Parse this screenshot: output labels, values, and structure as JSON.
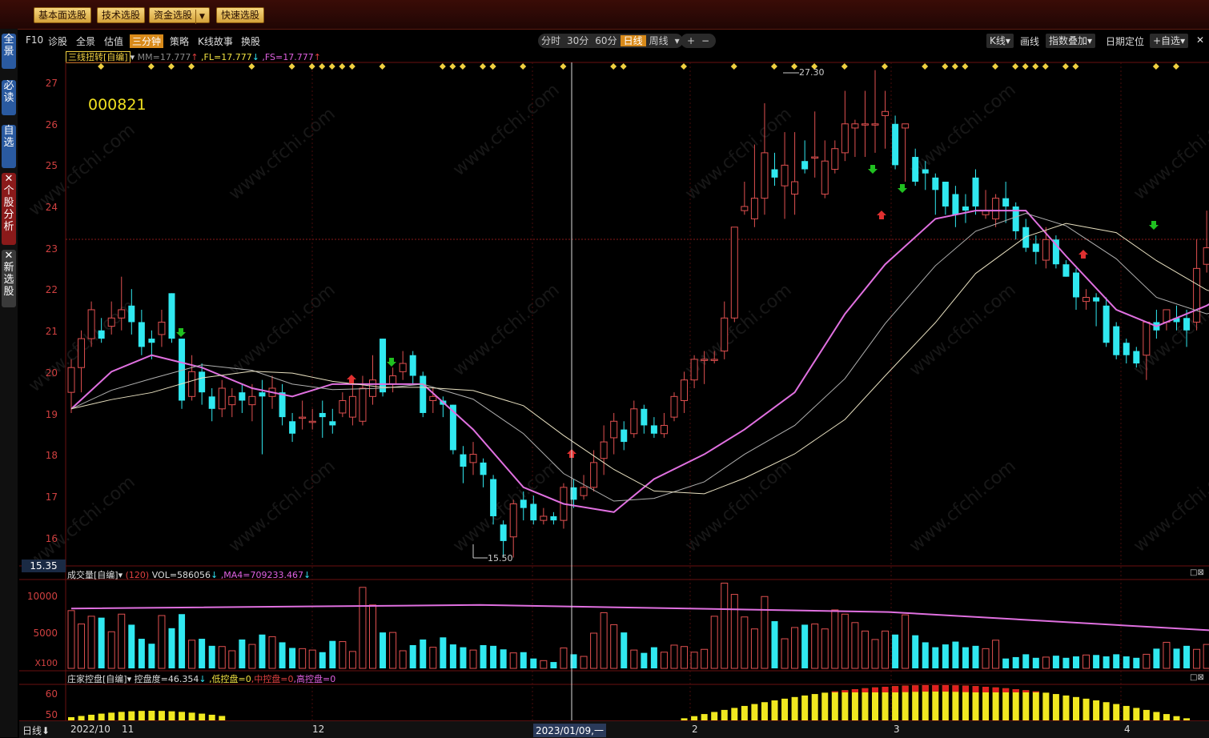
{
  "toolbar": {
    "buttons": [
      "基本面选股",
      "技术选股",
      "资金选股",
      "快速选股"
    ]
  },
  "left_tabs": [
    "全景",
    "必读",
    "自选",
    "个股分析",
    "新选股"
  ],
  "nav": {
    "items": [
      "F10",
      "诊股",
      "全景",
      "估值",
      "三分钟",
      "策略",
      "K线故事",
      "换股"
    ],
    "active": "三分钟",
    "periods": [
      "分时",
      "30分",
      "60分",
      "日线",
      "周线"
    ],
    "period_active": "日线",
    "zoom_in": "+",
    "zoom_out": "−",
    "right": [
      "K线",
      "画线",
      "指数叠加",
      "日期定位",
      "+自选"
    ]
  },
  "main_legend": {
    "name": "三线扭转[自编]",
    "mm": "MM=17.777",
    "fl": ",FL=17.777",
    "fs": ",FS=17.777"
  },
  "stock_code": "000821",
  "price_axis": [
    "27",
    "26",
    "25",
    "24",
    "23",
    "22",
    "21",
    "20",
    "19",
    "18",
    "17",
    "16"
  ],
  "current_price_label": "15.35",
  "high_label": "27.30",
  "low_label": "15.50",
  "volume_legend": {
    "name": "成交量[自编]",
    "period": "(120)",
    "vol": "VOL=586056",
    "ma": ",MA4=709233.467"
  },
  "volume_axis": [
    "10000",
    "5000",
    "X100"
  ],
  "control_legend": {
    "name": "庄家控盘[自编]",
    "degree": "控盘度=46.354",
    "low": ",低控盘=0",
    "mid": ",中控盘=0",
    "high": ",高控盘=0"
  },
  "control_axis": [
    "60",
    "50"
  ],
  "date_axis": {
    "period_button": "日线",
    "labels": [
      "2022/10",
      "11",
      "12",
      "2023/01/09,一",
      "2",
      "3",
      "4"
    ]
  },
  "watermark": "www.cfchi.com",
  "colors": {
    "up": "#e05050",
    "down": "#30e8f0",
    "ma_pink": "#e070e0",
    "ma_light": "#e8e0c0",
    "ma_gray": "#b0b0b0",
    "signal_diamond": "#f0d040",
    "buy_arrow": "#e03030",
    "sell_arrow": "#20c020"
  },
  "chart_data": {
    "type": "candlestick",
    "ylim": [
      15.3,
      27.4
    ],
    "candles": [
      [
        19.5,
        20.1,
        19.0,
        20.3
      ],
      [
        20.1,
        20.8,
        19.5,
        21.0
      ],
      [
        20.8,
        21.5,
        20.6,
        21.7
      ],
      [
        21.0,
        20.8,
        20.7,
        21.3
      ],
      [
        21.1,
        21.3,
        20.9,
        21.7
      ],
      [
        21.3,
        21.5,
        21.0,
        22.3
      ],
      [
        21.6,
        21.2,
        20.9,
        22.0
      ],
      [
        21.2,
        20.6,
        20.4,
        21.5
      ],
      [
        20.8,
        20.7,
        20.3,
        21.0
      ],
      [
        20.9,
        21.2,
        20.6,
        21.5
      ],
      [
        21.9,
        20.8,
        20.7,
        21.9
      ],
      [
        20.8,
        19.3,
        19.1,
        20.8
      ],
      [
        19.4,
        20.0,
        19.3,
        20.4
      ],
      [
        20.0,
        19.5,
        19.2,
        20.2
      ],
      [
        19.4,
        19.1,
        18.8,
        19.6
      ],
      [
        19.1,
        19.6,
        18.9,
        19.8
      ],
      [
        19.2,
        19.4,
        18.9,
        19.6
      ],
      [
        19.5,
        19.3,
        19.0,
        19.7
      ],
      [
        19.2,
        19.4,
        18.8,
        19.7
      ],
      [
        19.5,
        19.4,
        18.0,
        19.8
      ],
      [
        19.4,
        19.6,
        19.1,
        19.9
      ],
      [
        19.5,
        18.9,
        18.7,
        19.7
      ],
      [
        18.8,
        18.5,
        18.3,
        19.0
      ],
      [
        18.9,
        18.9,
        18.6,
        19.3
      ],
      [
        18.8,
        18.8,
        18.6,
        19.1
      ],
      [
        19.0,
        18.9,
        18.4,
        19.3
      ],
      [
        18.8,
        18.7,
        18.5,
        19.1
      ],
      [
        19.0,
        19.3,
        18.9,
        19.5
      ],
      [
        18.9,
        19.4,
        18.7,
        19.7
      ],
      [
        18.8,
        19.6,
        18.7,
        19.9
      ],
      [
        19.4,
        19.8,
        19.2,
        20.4
      ],
      [
        20.8,
        19.5,
        19.4,
        20.8
      ],
      [
        19.7,
        19.9,
        19.5,
        20.1
      ],
      [
        20.0,
        20.2,
        19.8,
        20.5
      ],
      [
        20.4,
        19.9,
        19.7,
        20.5
      ],
      [
        19.9,
        19.0,
        18.9,
        20.0
      ],
      [
        19.3,
        19.4,
        19.0,
        19.6
      ],
      [
        19.3,
        19.2,
        18.9,
        19.4
      ],
      [
        19.2,
        18.1,
        18.0,
        19.2
      ],
      [
        18.0,
        17.7,
        17.3,
        18.2
      ],
      [
        17.8,
        18.0,
        17.5,
        18.3
      ],
      [
        17.8,
        17.5,
        17.2,
        17.9
      ],
      [
        17.4,
        16.5,
        16.3,
        17.5
      ],
      [
        16.3,
        15.9,
        15.5,
        16.4
      ],
      [
        16.0,
        16.8,
        15.5,
        16.9
      ],
      [
        16.9,
        16.7,
        16.4,
        17.1
      ],
      [
        16.8,
        16.4,
        16.3,
        17.0
      ],
      [
        16.4,
        16.5,
        16.3,
        16.7
      ],
      [
        16.5,
        16.4,
        16.3,
        16.6
      ],
      [
        16.4,
        17.2,
        16.2,
        17.3
      ],
      [
        17.2,
        16.9,
        16.7,
        17.4
      ],
      [
        17.0,
        17.2,
        16.9,
        17.5
      ],
      [
        17.2,
        17.8,
        17.1,
        18.1
      ],
      [
        17.9,
        18.3,
        17.5,
        18.7
      ],
      [
        18.4,
        18.8,
        18.0,
        19.0
      ],
      [
        18.6,
        18.3,
        18.1,
        18.8
      ],
      [
        18.5,
        19.1,
        18.4,
        19.3
      ],
      [
        19.1,
        18.7,
        18.5,
        19.2
      ],
      [
        18.7,
        18.5,
        18.4,
        18.9
      ],
      [
        18.5,
        18.7,
        18.4,
        19.0
      ],
      [
        18.9,
        19.4,
        18.8,
        19.5
      ],
      [
        19.3,
        19.8,
        19.0,
        20.0
      ],
      [
        19.8,
        20.3,
        19.6,
        20.4
      ],
      [
        20.3,
        20.3,
        19.7,
        20.5
      ],
      [
        20.3,
        20.3,
        20.2,
        20.5
      ],
      [
        20.5,
        21.3,
        20.3,
        21.7
      ],
      [
        21.3,
        23.5,
        21.2,
        23.5
      ],
      [
        23.9,
        24.0,
        23.8,
        24.6
      ],
      [
        23.7,
        24.2,
        23.5,
        25.5
      ],
      [
        24.2,
        25.3,
        23.8,
        26.5
      ],
      [
        24.9,
        24.7,
        24.5,
        25.3
      ],
      [
        24.5,
        25.0,
        23.7,
        25.8
      ],
      [
        24.3,
        24.6,
        23.8,
        25.8
      ],
      [
        25.1,
        24.9,
        24.8,
        25.6
      ],
      [
        25.2,
        25.2,
        24.7,
        26.3
      ],
      [
        24.3,
        25.1,
        24.2,
        25.6
      ],
      [
        24.9,
        25.4,
        24.8,
        25.6
      ],
      [
        25.3,
        26.0,
        25.1,
        26.8
      ],
      [
        25.9,
        26.0,
        25.2,
        26.1
      ],
      [
        26.0,
        26.0,
        25.2,
        26.8
      ],
      [
        26.0,
        26.0,
        25.3,
        27.3
      ],
      [
        26.2,
        26.3,
        25.4,
        26.8
      ],
      [
        26.0,
        25.0,
        24.9,
        26.2
      ],
      [
        25.9,
        26.0,
        24.6,
        25.9
      ],
      [
        25.2,
        24.6,
        24.5,
        25.4
      ],
      [
        24.9,
        24.8,
        24.4,
        25.1
      ],
      [
        24.7,
        24.4,
        23.8,
        24.8
      ],
      [
        24.6,
        24.0,
        23.8,
        24.6
      ],
      [
        24.3,
        23.8,
        23.5,
        24.5
      ],
      [
        24.0,
        23.9,
        23.6,
        24.3
      ],
      [
        24.7,
        24.0,
        23.8,
        24.9
      ],
      [
        23.8,
        23.9,
        23.7,
        24.4
      ],
      [
        23.7,
        24.2,
        23.5,
        24.3
      ],
      [
        24.2,
        24.0,
        23.6,
        24.6
      ],
      [
        24.0,
        23.4,
        23.2,
        24.1
      ],
      [
        23.5,
        23.0,
        22.9,
        23.7
      ],
      [
        23.1,
        22.9,
        22.6,
        23.3
      ],
      [
        22.7,
        23.2,
        22.5,
        23.5
      ],
      [
        23.2,
        22.6,
        22.5,
        23.3
      ],
      [
        22.6,
        22.3,
        22.3,
        22.7
      ],
      [
        22.4,
        21.8,
        21.5,
        22.5
      ],
      [
        21.7,
        21.8,
        21.5,
        22.0
      ],
      [
        21.8,
        21.7,
        21.1,
        21.9
      ],
      [
        21.6,
        20.7,
        20.6,
        21.8
      ],
      [
        21.1,
        20.4,
        20.3,
        21.2
      ],
      [
        20.7,
        20.4,
        20.2,
        20.8
      ],
      [
        20.5,
        20.2,
        20.1,
        20.6
      ],
      [
        20.4,
        21.2,
        19.8,
        21.2
      ],
      [
        21.2,
        21.0,
        20.8,
        21.5
      ],
      [
        21.2,
        21.5,
        21.0,
        21.5
      ],
      [
        21.3,
        21.2,
        21.0,
        21.6
      ],
      [
        21.3,
        21.0,
        20.6,
        21.5
      ],
      [
        21.2,
        22.5,
        21.0,
        23.2
      ],
      [
        22.6,
        23.0,
        22.4,
        23.9
      ],
      [
        22.7,
        22.3,
        22.2,
        23.2
      ],
      [
        22.6,
        23.4,
        22.4,
        23.8
      ],
      [
        23.1,
        24.0,
        22.9,
        24.0
      ],
      [
        23.6,
        23.7,
        23.4,
        24.1
      ],
      [
        23.4,
        23.9,
        22.9,
        24.2
      ],
      [
        23.9,
        24.0,
        23.6,
        24.3
      ],
      [
        23.9,
        22.6,
        22.5,
        24.0
      ],
      [
        22.8,
        22.9,
        22.6,
        23.2
      ],
      [
        22.2,
        22.3,
        22.1,
        23.2
      ]
    ],
    "volume_ylim": [
      0,
      12000
    ],
    "volume": [
      8200,
      6300,
      7400,
      7200,
      5200,
      7700,
      6200,
      4200,
      3500,
      7500,
      5700,
      7700,
      4000,
      4200,
      3200,
      3100,
      2500,
      4100,
      3400,
      4800,
      4500,
      3700,
      2900,
      2800,
      2600,
      2300,
      3900,
      3800,
      2400,
      11500,
      9000,
      5100,
      5100,
      2500,
      3300,
      4100,
      3000,
      4400,
      3400,
      3000,
      2600,
      3300,
      3200,
      2700,
      2200,
      2300,
      1400,
      1100,
      900,
      2900,
      2000,
      1700,
      5000,
      7900,
      6200,
      5100,
      2600,
      2200,
      3000,
      2300,
      3300,
      3100,
      2300,
      2700,
      7400,
      12100,
      10500,
      7300,
      5600,
      10200,
      6700,
      4200,
      5800,
      6200,
      6300,
      5600,
      8300,
      7700,
      6500,
      5300,
      4100,
      5300,
      4800,
      7600,
      4700,
      3700,
      3000,
      3400,
      3800,
      3000,
      3200,
      2800,
      4000,
      1400,
      1600,
      2000,
      1500,
      1600,
      1800,
      1500,
      1700,
      1900,
      1900,
      1700,
      2000,
      1700,
      1500,
      2000,
      2800,
      3700,
      2800,
      3200,
      2700,
      3400,
      4400,
      10400,
      6100,
      7000,
      5200,
      6100,
      4900,
      4100,
      4000
    ],
    "volume_ma": [
      8500,
      9000,
      8000,
      4700
    ],
    "ma_pink": [
      19.1,
      20.0,
      20.4,
      20.1,
      19.6,
      19.4,
      19.7,
      19.7,
      19.7,
      18.6,
      17.2,
      16.8,
      16.6,
      17.4,
      18.0,
      18.6,
      19.5,
      21.4,
      22.6,
      23.7,
      23.9,
      23.9,
      22.8,
      21.5,
      21.1,
      21.6,
      22.3,
      22.7
    ]
  }
}
